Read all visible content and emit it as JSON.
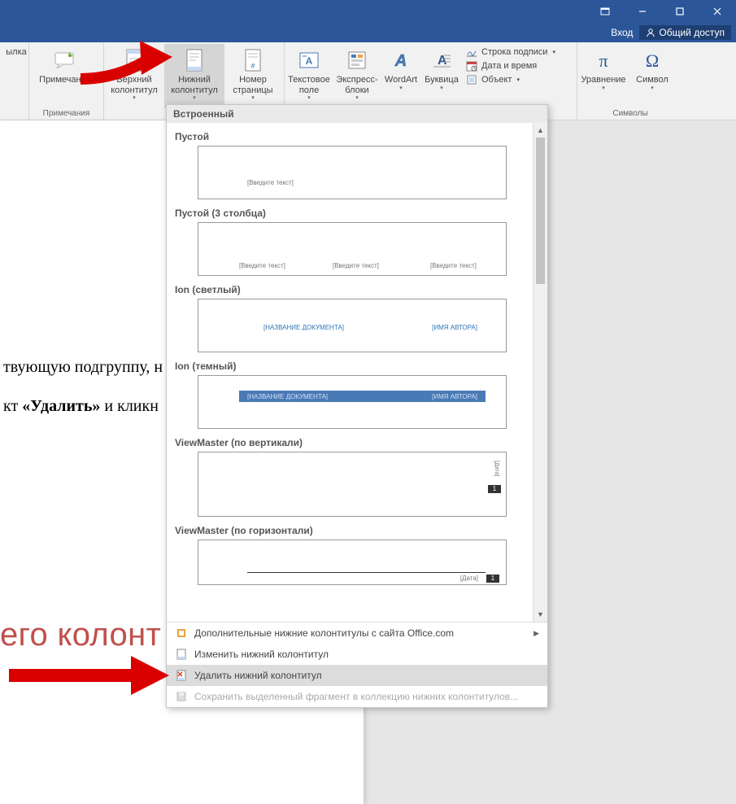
{
  "titlebar": {
    "signin": "Вход",
    "share": "Общий доступ"
  },
  "ribbon": {
    "link_partial": "ылка",
    "comment": "Примечание",
    "comments_group": "Примечания",
    "header": "Верхний колонтитул",
    "footer": "Нижний колонтитул",
    "page_number": "Номер страницы",
    "textbox": "Текстовое поле",
    "quick_parts": "Экспресс-блоки",
    "wordart": "WordArt",
    "dropcap": "Буквица",
    "sig_line": "Строка подписи",
    "datetime": "Дата и время",
    "object": "Объект",
    "equation": "Уравнение",
    "symbol": "Символ",
    "symbols_group": "Символы"
  },
  "gallery": {
    "header": "Встроенный",
    "tmpl1": "Пустой",
    "ph_enter": "[Введите текст]",
    "tmpl2": "Пустой (3 столбца)",
    "tmpl3": "Ion (светлый)",
    "ph_doc_title": "[НАЗВАНИЕ ДОКУМЕНТА]",
    "ph_author": "[ИМЯ АВТОРА]",
    "tmpl4": "Ion (темный)",
    "tmpl5": "ViewMaster (по вертикали)",
    "ph_date": "[Дата]",
    "page1": "1",
    "tmpl6": "ViewMaster (по горизонтали)",
    "more_office": "Дополнительные нижние колонтитулы с сайта Office.com",
    "edit_footer": "Изменить нижний колонтитул",
    "remove_footer": "Удалить нижний колонтитул",
    "save_selection": "Сохранить выделенный фрагмент в коллекцию нижних колонтитулов..."
  },
  "document": {
    "line1": "твующую подгруппу, н",
    "line2a": "кт ",
    "line2b": "«Удалить»",
    "line2c": " и кликн",
    "heading": "его колонт"
  }
}
